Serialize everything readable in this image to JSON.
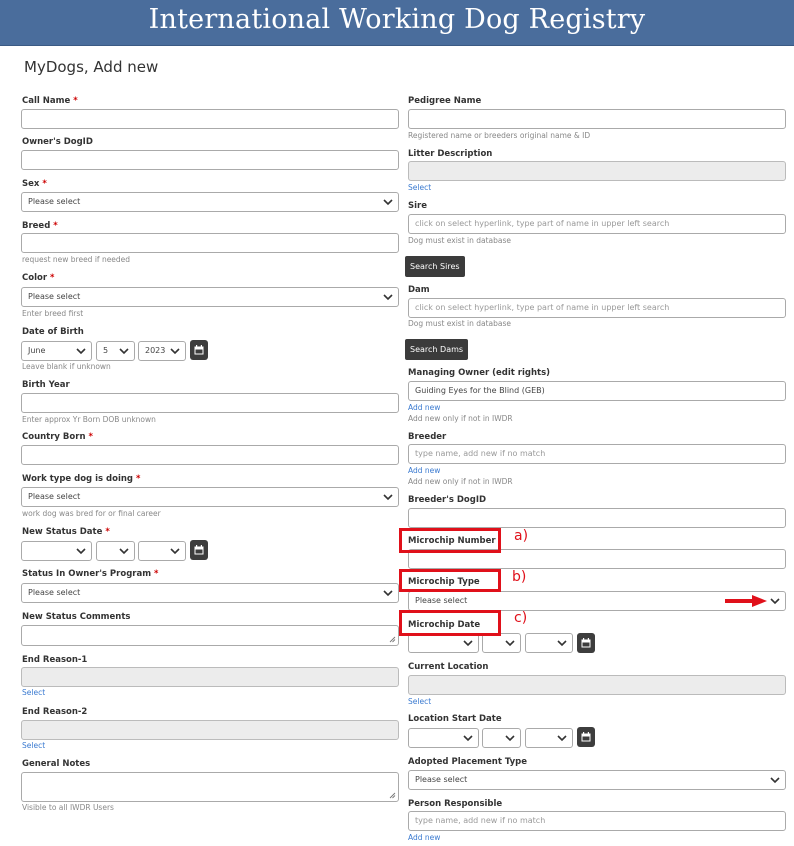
{
  "header": {
    "title": "International Working Dog Registry"
  },
  "page": {
    "title": "MyDogs, Add new"
  },
  "left": {
    "call_name": {
      "label": "Call Name",
      "required": "*"
    },
    "owners_dogid": {
      "label": "Owner's DogID"
    },
    "sex": {
      "label": "Sex",
      "required": "*",
      "value": "Please select"
    },
    "breed": {
      "label": "Breed",
      "required": "*",
      "help": "request new breed if needed"
    },
    "color": {
      "label": "Color",
      "required": "*",
      "value": "Please select",
      "help": "Enter breed first"
    },
    "dob": {
      "label": "Date of Birth",
      "month": "June",
      "day": "5",
      "year": "2023",
      "help": "Leave blank if unknown"
    },
    "birth_year": {
      "label": "Birth Year",
      "help": "Enter approx Yr Born DOB unknown"
    },
    "country_born": {
      "label": "Country Born",
      "required": "*"
    },
    "work_type": {
      "label": "Work type dog is doing",
      "required": "*",
      "value": "Please select",
      "help": "work dog was bred for or final career"
    },
    "new_status_date": {
      "label": "New Status Date",
      "required": "*"
    },
    "status_program": {
      "label": "Status In Owner's Program",
      "required": "*",
      "value": "Please select"
    },
    "new_status_comments": {
      "label": "New Status Comments"
    },
    "end_reason_1": {
      "label": "End Reason-1",
      "link": "Select"
    },
    "end_reason_2": {
      "label": "End Reason-2",
      "link": "Select"
    },
    "general_notes": {
      "label": "General Notes",
      "help": "Visible to all IWDR Users"
    }
  },
  "right": {
    "pedigree_name": {
      "label": "Pedigree Name",
      "help": "Registered name or breeders original name & ID"
    },
    "litter_description": {
      "label": "Litter Description",
      "link": "Select"
    },
    "sire": {
      "label": "Sire",
      "placeholder": "click on select hyperlink, type part of name in upper left search",
      "help": "Dog must exist in database",
      "button": "Search Sires"
    },
    "dam": {
      "label": "Dam",
      "placeholder": "click on select hyperlink, type part of name in upper left search",
      "help": "Dog must exist in database",
      "button": "Search Dams"
    },
    "managing_owner": {
      "label": "Managing Owner (edit rights)",
      "value": "Guiding Eyes for the Blind (GEB)",
      "link": "Add new",
      "help": "Add new only if not in IWDR"
    },
    "breeder": {
      "label": "Breeder",
      "placeholder": "type name, add new if no match",
      "link": "Add new",
      "help": "Add new only if not in IWDR"
    },
    "breeders_dogid": {
      "label": "Breeder's DogID"
    },
    "microchip_number": {
      "label": "Microchip Number"
    },
    "microchip_type": {
      "label": "Microchip Type",
      "value": "Please select"
    },
    "microchip_date": {
      "label": "Microchip Date"
    },
    "current_location": {
      "label": "Current Location",
      "link": "Select"
    },
    "location_start_date": {
      "label": "Location Start Date"
    },
    "adopted_placement_type": {
      "label": "Adopted Placement Type",
      "value": "Please select"
    },
    "person_responsible": {
      "label": "Person Responsible",
      "placeholder": "type name, add new if no match",
      "link": "Add new"
    }
  },
  "annotations": {
    "a": "a)",
    "b": "b)",
    "c": "c)"
  },
  "colors": {
    "banner": "#4a6d9c",
    "required": "#cc0000",
    "link": "#3a7ad0",
    "annotation": "#e0101a",
    "button": "#3b3b3b"
  }
}
